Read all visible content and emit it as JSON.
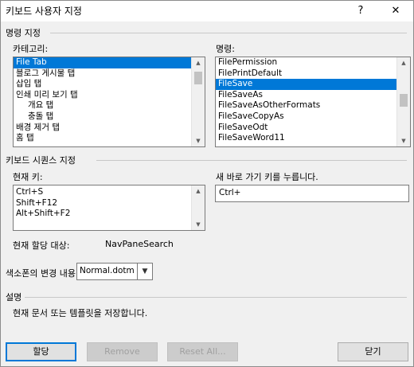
{
  "window": {
    "title": "키보드 사용자 지정",
    "help_label": "?",
    "close_label": "✕"
  },
  "commands_section": {
    "heading": "명령 지정",
    "categories_label": "카테고리:",
    "commands_label": "명령:",
    "categories": [
      {
        "label": "File Tab",
        "selected": true
      },
      {
        "label": "블로그 게시물 탭",
        "selected": false
      },
      {
        "label": "삽입 탭",
        "selected": false
      },
      {
        "label": "인쇄 미리 보기 탭",
        "selected": false
      },
      {
        "label": "개요 탭",
        "selected": false
      },
      {
        "label": "충돌 탭",
        "selected": false
      },
      {
        "label": "배경 제거 탭",
        "selected": false
      },
      {
        "label": "홈 탭",
        "selected": false
      }
    ],
    "commands": [
      {
        "label": "FilePermission",
        "selected": false
      },
      {
        "label": "FilePrintDefault",
        "selected": false
      },
      {
        "label": "FileSave",
        "selected": true
      },
      {
        "label": "FileSaveAs",
        "selected": false
      },
      {
        "label": "FileSaveAsOtherFormats",
        "selected": false
      },
      {
        "label": "FileSaveCopyAs",
        "selected": false
      },
      {
        "label": "FileSaveOdt",
        "selected": false
      },
      {
        "label": "FileSaveWord11",
        "selected": false
      }
    ]
  },
  "keyboard_section": {
    "heading": "키보드 시퀀스 지정",
    "current_keys_label": "현재 키:",
    "current_keys": [
      "Ctrl+S",
      "Shift+F12",
      "Alt+Shift+F2"
    ],
    "new_shortcut_label": "새 바로 가기 키를 누릅니다.",
    "new_shortcut_value": "Ctrl+",
    "assigned_to_label": "현재 할당 대상:",
    "assigned_to_value": "NavPaneSearch",
    "save_in_label": "색소폰의 변경 내용",
    "save_in_value": "Normal.dotm"
  },
  "description_section": {
    "heading": "설명",
    "text": "현재 문서 또는 템플릿을 저장합니다."
  },
  "buttons": {
    "assign": "할당",
    "remove": "Remove",
    "reset_all": "Reset All...",
    "close": "닫기"
  },
  "icons": {
    "scroll_up": "scroll-up-arrow-icon",
    "scroll_down": "scroll-down-arrow-icon",
    "dropdown": "chevron-down-icon"
  }
}
